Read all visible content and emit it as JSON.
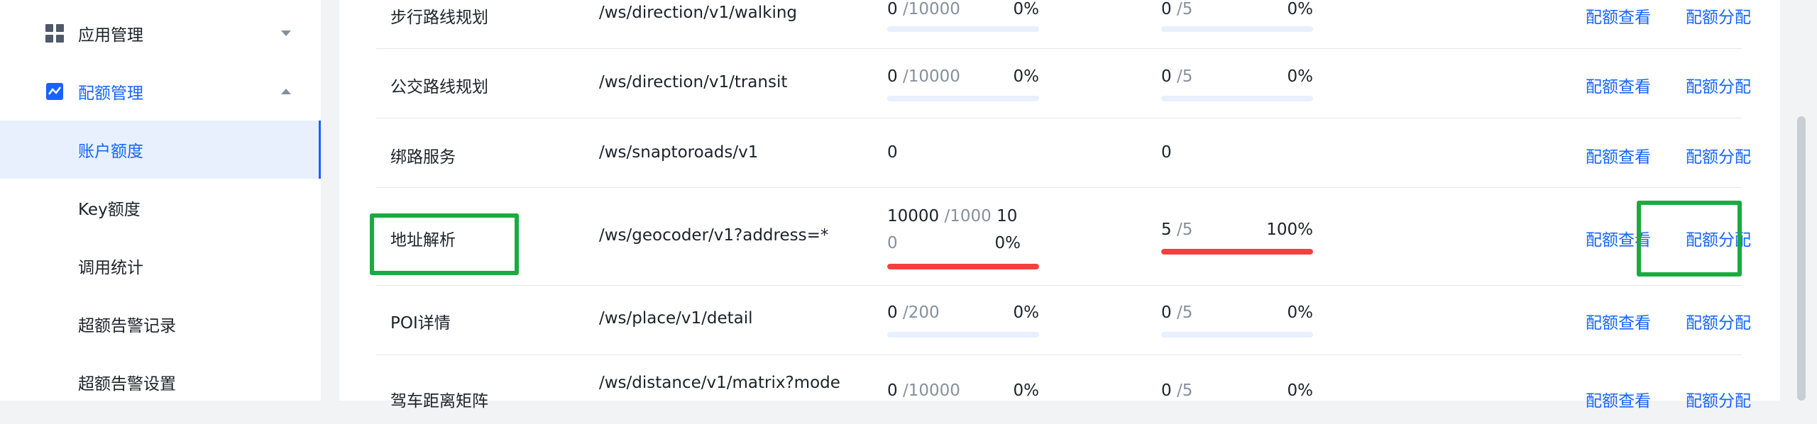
{
  "sidebar": {
    "items": [
      {
        "label": "应用管理"
      },
      {
        "label": "配额管理"
      },
      {
        "label": "账户额度"
      },
      {
        "label": "Key额度"
      },
      {
        "label": "调用统计"
      },
      {
        "label": "超额告警记录"
      },
      {
        "label": "超额告警设置"
      }
    ]
  },
  "table": {
    "rows": [
      {
        "name": "步行路线规划",
        "path": "/ws/direction/v1/walking",
        "q1": {
          "used": "0",
          "limit": " /10000",
          "pct": "0%",
          "fill": 0
        },
        "q2": {
          "used": "0",
          "limit": " /5",
          "pct": "0%",
          "fill": 0
        },
        "view": "配额查看",
        "alloc": "配额分配"
      },
      {
        "name": "公交路线规划",
        "path": "/ws/direction/v1/transit",
        "q1": {
          "used": "0",
          "limit": " /10000",
          "pct": "0%",
          "fill": 0
        },
        "q2": {
          "used": "0",
          "limit": " /5",
          "pct": "0%",
          "fill": 0
        },
        "view": "配额查看",
        "alloc": "配额分配"
      },
      {
        "name": "绑路服务",
        "path": "/ws/snaptoroads/v1",
        "q1_plain": "0",
        "q2_plain": "0",
        "view": "配额查看",
        "alloc": "配额分配"
      },
      {
        "name": "地址解析",
        "path": "/ws/geocoder/v1?address=*",
        "q1": {
          "used": "10000",
          "limit": " /1000",
          "limit_tail": " 10",
          "limit_line2": "0",
          "pct": "0%",
          "fill": 1
        },
        "q2": {
          "used": "5",
          "limit": " /5",
          "pct": "100%",
          "fill": 1
        },
        "view": "配额查看",
        "alloc": "配额分配"
      },
      {
        "name": "POI详情",
        "path": "/ws/place/v1/detail",
        "q1": {
          "used": "0",
          "limit": " /200",
          "pct": "0%",
          "fill": 0
        },
        "q2": {
          "used": "0",
          "limit": " /5",
          "pct": "0%",
          "fill": 0
        },
        "view": "配额查看",
        "alloc": "配额分配"
      },
      {
        "name": "驾车距离矩阵",
        "path": "/ws/distance/v1/matrix?mode",
        "q1": {
          "used": "0",
          "limit": " /10000",
          "pct": "0%",
          "fill": 0
        },
        "q2": {
          "used": "0",
          "limit": " /5",
          "pct": "0%",
          "fill": 0
        },
        "view": "配额查看",
        "alloc": "配额分配"
      }
    ]
  },
  "colors": {
    "accent": "#1664ff",
    "danger": "#f53f3f",
    "highlight": "#1aab40"
  }
}
